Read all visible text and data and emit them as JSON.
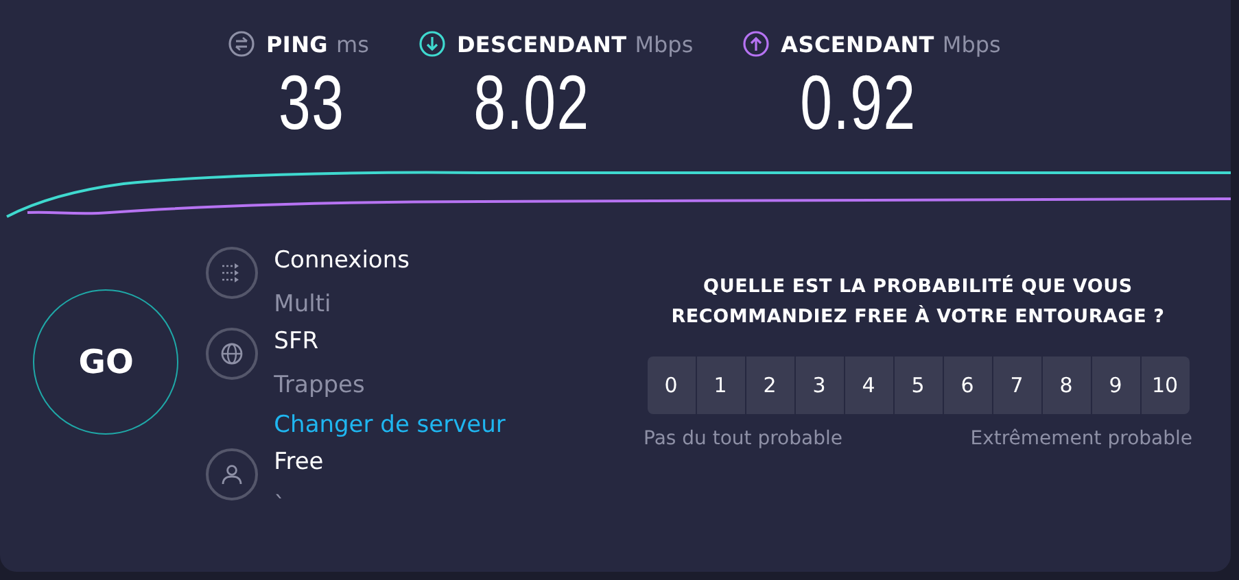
{
  "metrics": [
    {
      "kind": "ping",
      "label": "PING",
      "unit": "ms",
      "value": "33"
    },
    {
      "kind": "download",
      "label": "DESCENDANT",
      "unit": "Mbps",
      "value": "8.02"
    },
    {
      "kind": "upload",
      "label": "ASCENDANT",
      "unit": "Mbps",
      "value": "0.92"
    }
  ],
  "go_button": "GO",
  "info": [
    {
      "kind": "connections",
      "title": "Connexions",
      "subtitle": "Multi"
    },
    {
      "kind": "server",
      "title": "SFR",
      "subtitle": "Trappes",
      "link": "Changer de serveur"
    },
    {
      "kind": "provider",
      "title": "Free",
      "subtitle": "`"
    }
  ],
  "survey": {
    "question": "QUELLE EST LA PROBABILITÉ QUE VOUS RECOMMANDIEZ FREE À VOTRE ENTOURAGE ?",
    "scores": [
      "0",
      "1",
      "2",
      "3",
      "4",
      "5",
      "6",
      "7",
      "8",
      "9",
      "10"
    ],
    "low_label": "Pas du tout probable",
    "high_label": "Extrêmement probable"
  }
}
